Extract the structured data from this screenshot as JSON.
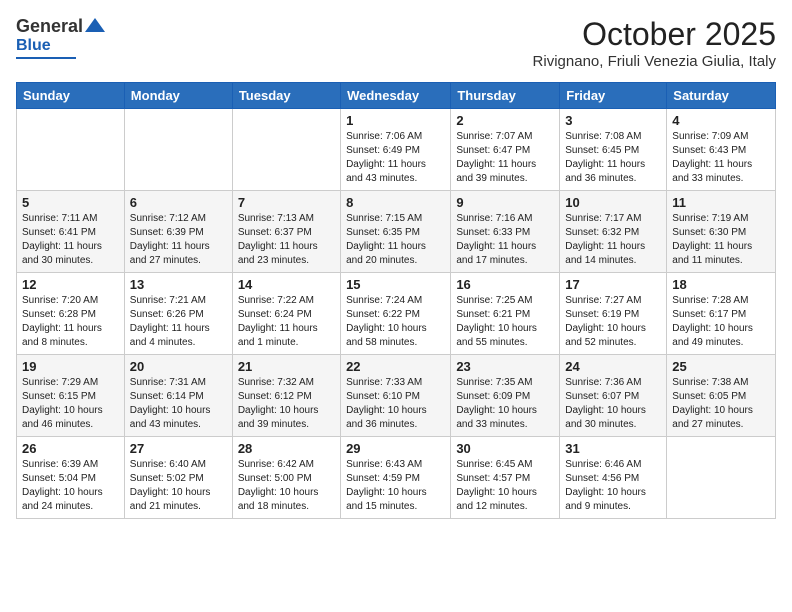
{
  "header": {
    "logo_general": "General",
    "logo_blue": "Blue",
    "month_title": "October 2025",
    "location": "Rivignano, Friuli Venezia Giulia, Italy"
  },
  "weekdays": [
    "Sunday",
    "Monday",
    "Tuesday",
    "Wednesday",
    "Thursday",
    "Friday",
    "Saturday"
  ],
  "weeks": [
    [
      {
        "day": "",
        "info": ""
      },
      {
        "day": "",
        "info": ""
      },
      {
        "day": "",
        "info": ""
      },
      {
        "day": "1",
        "info": "Sunrise: 7:06 AM\nSunset: 6:49 PM\nDaylight: 11 hours and 43 minutes."
      },
      {
        "day": "2",
        "info": "Sunrise: 7:07 AM\nSunset: 6:47 PM\nDaylight: 11 hours and 39 minutes."
      },
      {
        "day": "3",
        "info": "Sunrise: 7:08 AM\nSunset: 6:45 PM\nDaylight: 11 hours and 36 minutes."
      },
      {
        "day": "4",
        "info": "Sunrise: 7:09 AM\nSunset: 6:43 PM\nDaylight: 11 hours and 33 minutes."
      }
    ],
    [
      {
        "day": "5",
        "info": "Sunrise: 7:11 AM\nSunset: 6:41 PM\nDaylight: 11 hours and 30 minutes."
      },
      {
        "day": "6",
        "info": "Sunrise: 7:12 AM\nSunset: 6:39 PM\nDaylight: 11 hours and 27 minutes."
      },
      {
        "day": "7",
        "info": "Sunrise: 7:13 AM\nSunset: 6:37 PM\nDaylight: 11 hours and 23 minutes."
      },
      {
        "day": "8",
        "info": "Sunrise: 7:15 AM\nSunset: 6:35 PM\nDaylight: 11 hours and 20 minutes."
      },
      {
        "day": "9",
        "info": "Sunrise: 7:16 AM\nSunset: 6:33 PM\nDaylight: 11 hours and 17 minutes."
      },
      {
        "day": "10",
        "info": "Sunrise: 7:17 AM\nSunset: 6:32 PM\nDaylight: 11 hours and 14 minutes."
      },
      {
        "day": "11",
        "info": "Sunrise: 7:19 AM\nSunset: 6:30 PM\nDaylight: 11 hours and 11 minutes."
      }
    ],
    [
      {
        "day": "12",
        "info": "Sunrise: 7:20 AM\nSunset: 6:28 PM\nDaylight: 11 hours and 8 minutes."
      },
      {
        "day": "13",
        "info": "Sunrise: 7:21 AM\nSunset: 6:26 PM\nDaylight: 11 hours and 4 minutes."
      },
      {
        "day": "14",
        "info": "Sunrise: 7:22 AM\nSunset: 6:24 PM\nDaylight: 11 hours and 1 minute."
      },
      {
        "day": "15",
        "info": "Sunrise: 7:24 AM\nSunset: 6:22 PM\nDaylight: 10 hours and 58 minutes."
      },
      {
        "day": "16",
        "info": "Sunrise: 7:25 AM\nSunset: 6:21 PM\nDaylight: 10 hours and 55 minutes."
      },
      {
        "day": "17",
        "info": "Sunrise: 7:27 AM\nSunset: 6:19 PM\nDaylight: 10 hours and 52 minutes."
      },
      {
        "day": "18",
        "info": "Sunrise: 7:28 AM\nSunset: 6:17 PM\nDaylight: 10 hours and 49 minutes."
      }
    ],
    [
      {
        "day": "19",
        "info": "Sunrise: 7:29 AM\nSunset: 6:15 PM\nDaylight: 10 hours and 46 minutes."
      },
      {
        "day": "20",
        "info": "Sunrise: 7:31 AM\nSunset: 6:14 PM\nDaylight: 10 hours and 43 minutes."
      },
      {
        "day": "21",
        "info": "Sunrise: 7:32 AM\nSunset: 6:12 PM\nDaylight: 10 hours and 39 minutes."
      },
      {
        "day": "22",
        "info": "Sunrise: 7:33 AM\nSunset: 6:10 PM\nDaylight: 10 hours and 36 minutes."
      },
      {
        "day": "23",
        "info": "Sunrise: 7:35 AM\nSunset: 6:09 PM\nDaylight: 10 hours and 33 minutes."
      },
      {
        "day": "24",
        "info": "Sunrise: 7:36 AM\nSunset: 6:07 PM\nDaylight: 10 hours and 30 minutes."
      },
      {
        "day": "25",
        "info": "Sunrise: 7:38 AM\nSunset: 6:05 PM\nDaylight: 10 hours and 27 minutes."
      }
    ],
    [
      {
        "day": "26",
        "info": "Sunrise: 6:39 AM\nSunset: 5:04 PM\nDaylight: 10 hours and 24 minutes."
      },
      {
        "day": "27",
        "info": "Sunrise: 6:40 AM\nSunset: 5:02 PM\nDaylight: 10 hours and 21 minutes."
      },
      {
        "day": "28",
        "info": "Sunrise: 6:42 AM\nSunset: 5:00 PM\nDaylight: 10 hours and 18 minutes."
      },
      {
        "day": "29",
        "info": "Sunrise: 6:43 AM\nSunset: 4:59 PM\nDaylight: 10 hours and 15 minutes."
      },
      {
        "day": "30",
        "info": "Sunrise: 6:45 AM\nSunset: 4:57 PM\nDaylight: 10 hours and 12 minutes."
      },
      {
        "day": "31",
        "info": "Sunrise: 6:46 AM\nSunset: 4:56 PM\nDaylight: 10 hours and 9 minutes."
      },
      {
        "day": "",
        "info": ""
      }
    ]
  ]
}
